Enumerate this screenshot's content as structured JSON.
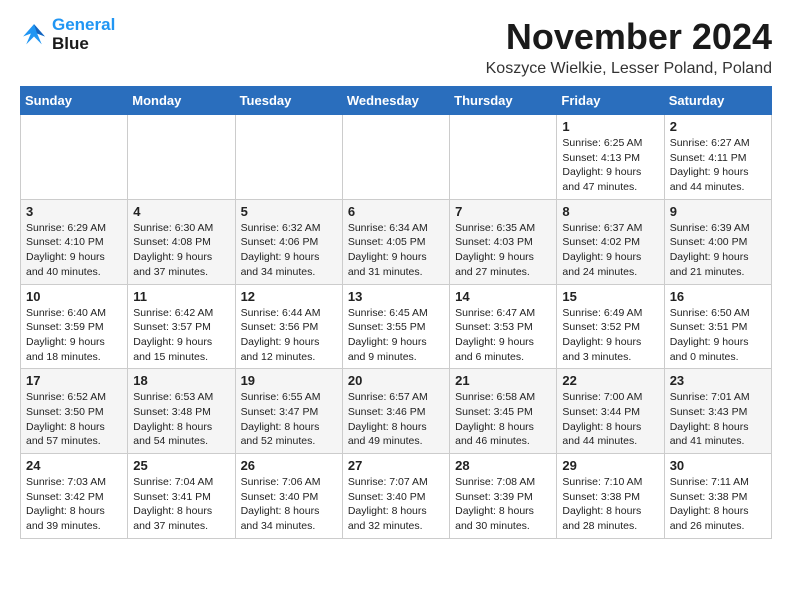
{
  "header": {
    "logo_line1": "General",
    "logo_line2": "Blue",
    "month": "November 2024",
    "location": "Koszyce Wielkie, Lesser Poland, Poland"
  },
  "weekdays": [
    "Sunday",
    "Monday",
    "Tuesday",
    "Wednesday",
    "Thursday",
    "Friday",
    "Saturday"
  ],
  "weeks": [
    [
      {
        "day": "",
        "info": ""
      },
      {
        "day": "",
        "info": ""
      },
      {
        "day": "",
        "info": ""
      },
      {
        "day": "",
        "info": ""
      },
      {
        "day": "",
        "info": ""
      },
      {
        "day": "1",
        "info": "Sunrise: 6:25 AM\nSunset: 4:13 PM\nDaylight: 9 hours\nand 47 minutes."
      },
      {
        "day": "2",
        "info": "Sunrise: 6:27 AM\nSunset: 4:11 PM\nDaylight: 9 hours\nand 44 minutes."
      }
    ],
    [
      {
        "day": "3",
        "info": "Sunrise: 6:29 AM\nSunset: 4:10 PM\nDaylight: 9 hours\nand 40 minutes."
      },
      {
        "day": "4",
        "info": "Sunrise: 6:30 AM\nSunset: 4:08 PM\nDaylight: 9 hours\nand 37 minutes."
      },
      {
        "day": "5",
        "info": "Sunrise: 6:32 AM\nSunset: 4:06 PM\nDaylight: 9 hours\nand 34 minutes."
      },
      {
        "day": "6",
        "info": "Sunrise: 6:34 AM\nSunset: 4:05 PM\nDaylight: 9 hours\nand 31 minutes."
      },
      {
        "day": "7",
        "info": "Sunrise: 6:35 AM\nSunset: 4:03 PM\nDaylight: 9 hours\nand 27 minutes."
      },
      {
        "day": "8",
        "info": "Sunrise: 6:37 AM\nSunset: 4:02 PM\nDaylight: 9 hours\nand 24 minutes."
      },
      {
        "day": "9",
        "info": "Sunrise: 6:39 AM\nSunset: 4:00 PM\nDaylight: 9 hours\nand 21 minutes."
      }
    ],
    [
      {
        "day": "10",
        "info": "Sunrise: 6:40 AM\nSunset: 3:59 PM\nDaylight: 9 hours\nand 18 minutes."
      },
      {
        "day": "11",
        "info": "Sunrise: 6:42 AM\nSunset: 3:57 PM\nDaylight: 9 hours\nand 15 minutes."
      },
      {
        "day": "12",
        "info": "Sunrise: 6:44 AM\nSunset: 3:56 PM\nDaylight: 9 hours\nand 12 minutes."
      },
      {
        "day": "13",
        "info": "Sunrise: 6:45 AM\nSunset: 3:55 PM\nDaylight: 9 hours\nand 9 minutes."
      },
      {
        "day": "14",
        "info": "Sunrise: 6:47 AM\nSunset: 3:53 PM\nDaylight: 9 hours\nand 6 minutes."
      },
      {
        "day": "15",
        "info": "Sunrise: 6:49 AM\nSunset: 3:52 PM\nDaylight: 9 hours\nand 3 minutes."
      },
      {
        "day": "16",
        "info": "Sunrise: 6:50 AM\nSunset: 3:51 PM\nDaylight: 9 hours\nand 0 minutes."
      }
    ],
    [
      {
        "day": "17",
        "info": "Sunrise: 6:52 AM\nSunset: 3:50 PM\nDaylight: 8 hours\nand 57 minutes."
      },
      {
        "day": "18",
        "info": "Sunrise: 6:53 AM\nSunset: 3:48 PM\nDaylight: 8 hours\nand 54 minutes."
      },
      {
        "day": "19",
        "info": "Sunrise: 6:55 AM\nSunset: 3:47 PM\nDaylight: 8 hours\nand 52 minutes."
      },
      {
        "day": "20",
        "info": "Sunrise: 6:57 AM\nSunset: 3:46 PM\nDaylight: 8 hours\nand 49 minutes."
      },
      {
        "day": "21",
        "info": "Sunrise: 6:58 AM\nSunset: 3:45 PM\nDaylight: 8 hours\nand 46 minutes."
      },
      {
        "day": "22",
        "info": "Sunrise: 7:00 AM\nSunset: 3:44 PM\nDaylight: 8 hours\nand 44 minutes."
      },
      {
        "day": "23",
        "info": "Sunrise: 7:01 AM\nSunset: 3:43 PM\nDaylight: 8 hours\nand 41 minutes."
      }
    ],
    [
      {
        "day": "24",
        "info": "Sunrise: 7:03 AM\nSunset: 3:42 PM\nDaylight: 8 hours\nand 39 minutes."
      },
      {
        "day": "25",
        "info": "Sunrise: 7:04 AM\nSunset: 3:41 PM\nDaylight: 8 hours\nand 37 minutes."
      },
      {
        "day": "26",
        "info": "Sunrise: 7:06 AM\nSunset: 3:40 PM\nDaylight: 8 hours\nand 34 minutes."
      },
      {
        "day": "27",
        "info": "Sunrise: 7:07 AM\nSunset: 3:40 PM\nDaylight: 8 hours\nand 32 minutes."
      },
      {
        "day": "28",
        "info": "Sunrise: 7:08 AM\nSunset: 3:39 PM\nDaylight: 8 hours\nand 30 minutes."
      },
      {
        "day": "29",
        "info": "Sunrise: 7:10 AM\nSunset: 3:38 PM\nDaylight: 8 hours\nand 28 minutes."
      },
      {
        "day": "30",
        "info": "Sunrise: 7:11 AM\nSunset: 3:38 PM\nDaylight: 8 hours\nand 26 minutes."
      }
    ]
  ]
}
